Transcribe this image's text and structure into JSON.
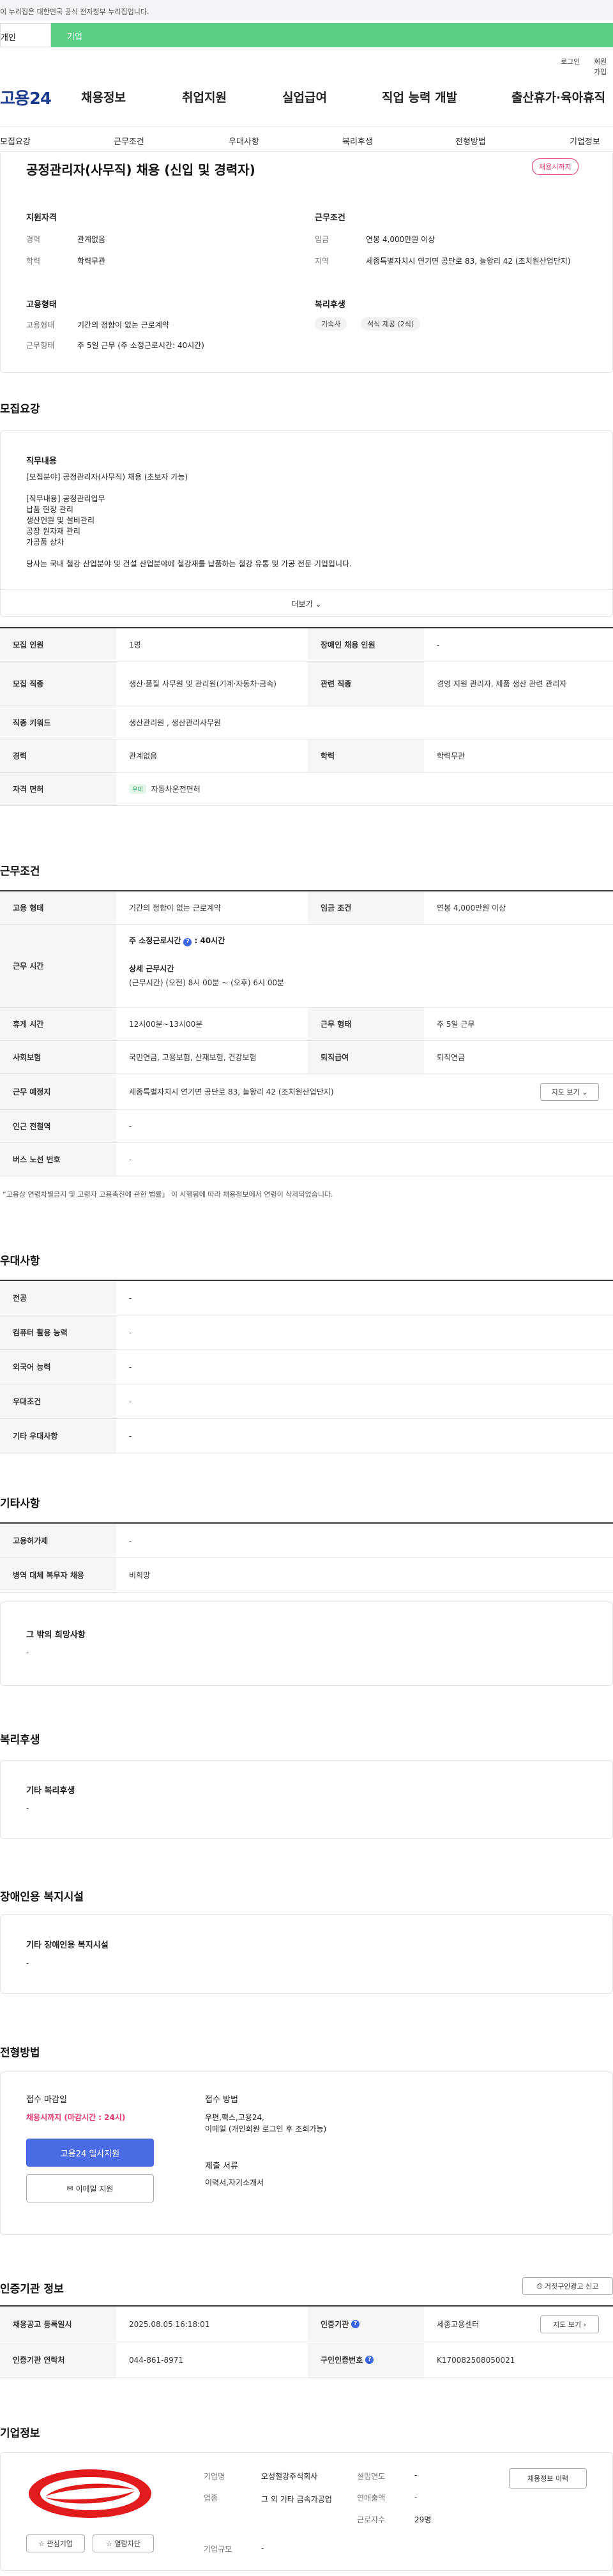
{
  "gov_notice": "이 누리집은 대한민국 공식 전자정부 누리집입니다.",
  "tabs": {
    "personal": "개인",
    "company": "기업"
  },
  "util": {
    "login": "로그인",
    "join": "회원가입"
  },
  "logo": "고용24",
  "gnb": [
    "채용정보",
    "취업지원",
    "실업급여",
    "직업 능력 개발",
    "출산휴가·육아휴직"
  ],
  "subnav": [
    "모집요강",
    "근무조건",
    "우대사항",
    "복리후생",
    "전형방법",
    "기업정보"
  ],
  "summary": {
    "title": "공정관리자(사무직) 채용 (신입 및 경력자)",
    "status_badge": "채용시까지",
    "qual_h": "지원자격",
    "career_l": "경력",
    "career_v": "관계없음",
    "edu_l": "학력",
    "edu_v": "학력무관",
    "cond_h": "근무조건",
    "wage_l": "임금",
    "wage_v": "연봉 4,000만원 이상",
    "area_l": "지역",
    "area_v": "세종특별자치시 연기면 공단로 83, 늘왕리 42 (조치원산업단지)",
    "emp_h": "고용형태",
    "emp_type_l": "고용형태",
    "emp_type_v": "기간의 정함이 없는 근로계약",
    "work_type_l": "근무형태",
    "work_type_v": "주 5일 근무 (주 소정근로시간: 40시간)",
    "welfare_h": "복리후생",
    "welfare_chips": [
      "기숙사",
      "석식 제공 (2식)"
    ]
  },
  "recruit": {
    "section_title": "모집요강",
    "duty_h": "직무내용",
    "duty_text": "[모집분야] 공정관리자(사무직) 채용 (초보자 가능)\n\n[직무내용] 공정관리업무\n              납품 현장 관리\n              생산인원 및 설비관리\n              공장 원자재 관리\n              가공품 상차\n\n당사는 국내 철강 산업분야 및 건설 산업분야에 철강재를 납품하는 철강 유통 및 가공 전문 기업입니다.",
    "more": "더보기",
    "rows": [
      {
        "l1": "모집 인원",
        "v1": "1명",
        "l2": "장애인 채용 인원",
        "v2": "-"
      },
      {
        "l1": "모집 직종",
        "v1": "생산·품질 사무원 및 관리원(기계·자동차·금속)",
        "l2": "관련 직종",
        "v2": "경영 지원 관리자, 제품 생산 관련 관리자"
      },
      {
        "l1": "직종 키워드",
        "v1": "생산관리원 , 생산관리사무원"
      },
      {
        "l1": "경력",
        "v1": "관계없음",
        "l2": "학력",
        "v2": "학력무관"
      },
      {
        "l1": "자격 면허",
        "chip": "우대",
        "v1": "자동차운전면허"
      }
    ]
  },
  "workcond": {
    "section_title": "근무조건",
    "emp_l": "고용 형태",
    "emp_v": "기간의 정함이 없는 근로계약",
    "wage_l": "임금 조건",
    "wage_v": "연봉 4,000만원 이상",
    "hours_l": "근무 시간",
    "hours_main_prefix": "주 소정근로시간",
    "hours_main_suffix": ": 40시간",
    "hours_detail_h": "상세 근무시간",
    "hours_detail": "(근무시간) (오전) 8시 00분 ~ (오후) 6시 00분",
    "rest_l": "휴게 시간",
    "rest_v": "12시00분~13시00분",
    "shape_l": "근무 형태",
    "shape_v": "주 5일 근무",
    "ins_l": "사회보험",
    "ins_v": "국민연금, 고용보험, 산재보험, 건강보험",
    "sev_l": "퇴직급여",
    "sev_v": "퇴직연금",
    "place_l": "근무 예정지",
    "place_v": "세종특별자치시 연기면 공단로 83, 늘왕리 42 (조치원산업단지)",
    "map_btn": "지도 보기",
    "subway_l": "인근 전철역",
    "subway_v": "-",
    "bus_l": "버스 노선 번호",
    "bus_v": "-",
    "note": "“고용상 연령차별금지 및 고령자 고용촉진에 관한 법률」 이 시행됨에 따라 채용정보에서 연령이 삭제되었습니다."
  },
  "pref": {
    "section_title": "우대사항",
    "rows": [
      {
        "l": "전공",
        "v": "-"
      },
      {
        "l": "컴퓨터 활용 능력",
        "v": "-"
      },
      {
        "l": "외국어 능력",
        "v": "-"
      },
      {
        "l": "우대조건",
        "v": "-"
      },
      {
        "l": "기타 우대사항",
        "v": "-"
      }
    ]
  },
  "etc": {
    "section_title": "기타사항",
    "rows": [
      {
        "l": "고용허가제",
        "v": "-"
      },
      {
        "l": "병역 대체 복무자 채용",
        "v": "비희망"
      }
    ],
    "wish_h": "그 밖의 희망사항",
    "wish_v": "-"
  },
  "welfare": {
    "section_title": "복리후생",
    "h": "기타 복리후생",
    "v": "-"
  },
  "disab": {
    "section_title": "장애인용 복지시설",
    "h": "기타 장애인용 복지시설",
    "v": "-"
  },
  "screen": {
    "section_title": "전형방법",
    "deadline_h": "접수 마감일",
    "deadline_v": "채용시까지 (마감시간 : 24시)",
    "apply_btn": "고용24 입사지원",
    "email_btn": "이메일 지원",
    "method_h": "접수 방법",
    "method_v": "우편,팩스,고용24,\n이메일 (개인회원 로그인 후 조회가능)",
    "docs_h": "제출 서류",
    "docs_v": "이력서,자기소개서"
  },
  "cert": {
    "section_title": "인증기관 정보",
    "report_btn": "거짓구인광고 신고",
    "reg_l": "채용공고 등록일시",
    "reg_v": "2025.08.05 16:18:01",
    "org_l": "인증기관",
    "org_v": "세종고용센터",
    "map_btn": "지도 보기",
    "tel_l": "인증기관 연락처",
    "tel_v": "044-861-8971",
    "no_l": "구인인증번호",
    "no_v": "K170082508050021"
  },
  "company": {
    "section_title": "기업정보",
    "interest_btn": "관심기업",
    "block_btn": "열람차단",
    "name_l": "기업명",
    "name_v": "오성철강주식회사",
    "ind_l": "업종",
    "ind_v": "그 외 기타 금속가공업",
    "size_l": "기업규모",
    "size_v": "-",
    "est_l": "설립연도",
    "est_v": "-",
    "sales_l": "연매출액",
    "sales_v": "-",
    "staff_l": "근로자수",
    "staff_v": "29명",
    "history_btn": "채용정보 이력"
  },
  "colors": {
    "green": "#5ecf86",
    "pink": "#e43b76",
    "blue": "#4b6be4",
    "navy": "#1b3a8c"
  }
}
